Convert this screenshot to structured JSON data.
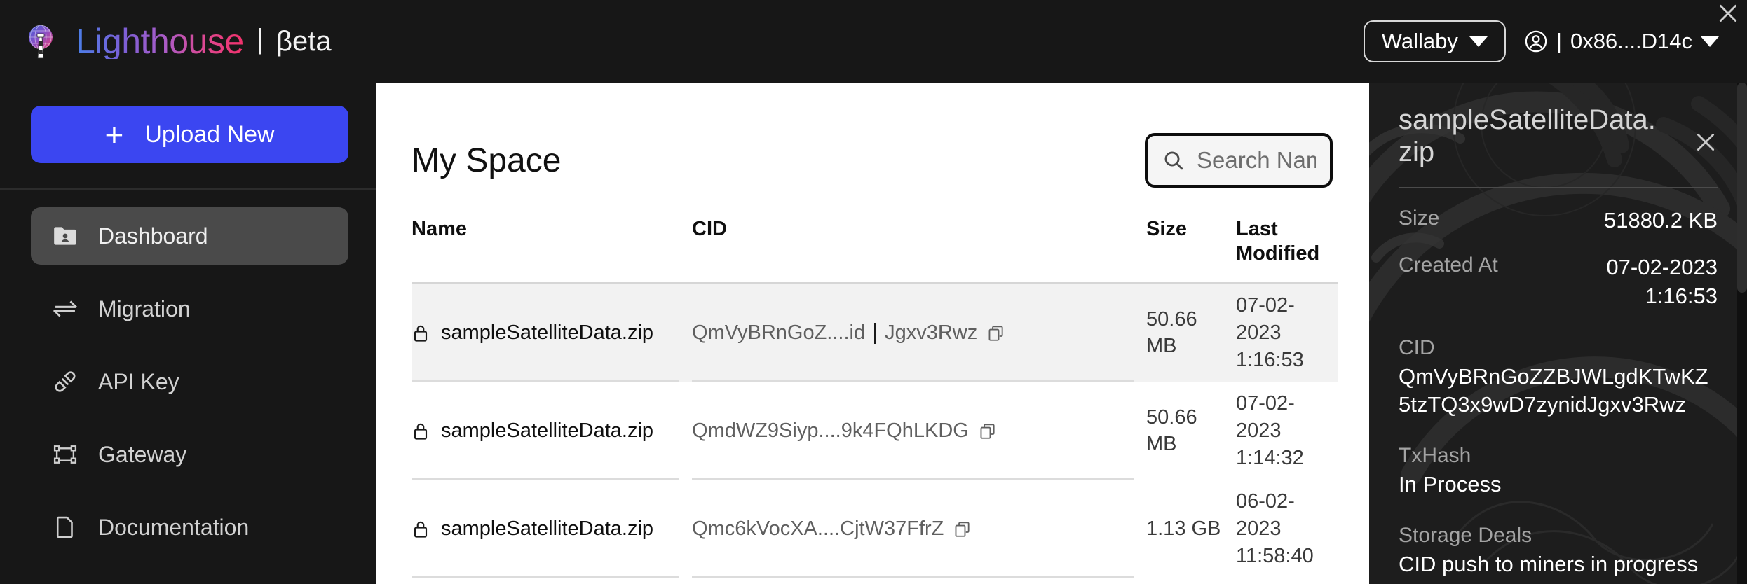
{
  "app": {
    "brand_name": "Lighthouse",
    "brand_separator": "|",
    "brand_tag": "βeta",
    "accent_blue": "#3b46f1",
    "panel_bg": "#1d1d1d",
    "dark_bg": "#171717"
  },
  "topbar": {
    "network_label": "Wallaby",
    "account_separator": "|",
    "account_address": "0x86....D14c",
    "window_close": "×"
  },
  "sidebar": {
    "upload_label": "Upload New",
    "upload_icon": "plus-icon",
    "items": [
      {
        "label": "Dashboard",
        "icon": "folder-user-icon",
        "active": true
      },
      {
        "label": "Migration",
        "icon": "swap-arrows-icon",
        "active": false
      },
      {
        "label": "API Key",
        "icon": "plug-connector-icon",
        "active": false
      },
      {
        "label": "Gateway",
        "icon": "bounding-box-icon",
        "active": false
      },
      {
        "label": "Documentation",
        "icon": "document-page-icon",
        "active": false
      }
    ]
  },
  "main": {
    "title": "My Space",
    "search": {
      "placeholder": "Search Name",
      "value": "",
      "icon": "search-icon"
    },
    "table": {
      "columns": [
        "Name",
        "CID",
        "Size",
        "Last Modified"
      ],
      "last_modified_line1": "Last",
      "last_modified_line2": "Modified",
      "rows": [
        {
          "name": "sampleSatelliteData.zip",
          "cid_prefix": "QmVyBRnGoZ....id",
          "cid_suffix": "Jgxv3Rwz",
          "cid": "QmVyBRnGoZ....idJgxv3Rwz",
          "size": "50.66 MB",
          "size_line1": "50.66",
          "size_line2": "MB",
          "modified_line1": "07-02-",
          "modified_line2": "2023",
          "modified_line3": "1:16:53",
          "highlighted": true
        },
        {
          "name": "sampleSatelliteData.zip",
          "cid_prefix": "QmdWZ9Siyp....9k4FQhLKDG",
          "cid_suffix": "",
          "cid": "QmdWZ9Siyp....9k4FQhLKDG",
          "size": "50.66 MB",
          "size_line1": "50.66",
          "size_line2": "MB",
          "modified_line1": "07-02-",
          "modified_line2": "2023",
          "modified_line3": "1:14:32",
          "highlighted": false
        },
        {
          "name": "sampleSatelliteData.zip",
          "cid_prefix": "Qmc6kVocXA....CjtW37FfrZ",
          "cid_suffix": "",
          "cid": "Qmc6kVocXA....CjtW37FfrZ",
          "size": "1.13 GB",
          "size_line1": "1.13 GB",
          "size_line2": "",
          "modified_line1": "06-02-",
          "modified_line2": "2023",
          "modified_line3": "11:58:40",
          "highlighted": false
        }
      ]
    }
  },
  "detail": {
    "title": "sampleSatelliteData.zip",
    "close_icon": "close-icon",
    "size_label": "Size",
    "size_value": "51880.2 KB",
    "created_label": "Created At",
    "created_value_line1": "07-02-2023",
    "created_value_line2": "1:16:53",
    "cid_label": "CID",
    "cid_value": "QmVyBRnGoZZBJWLgdKTwKZ5tzTQ3x9wD7zynidJgxv3Rwz",
    "txhash_label": "TxHash",
    "txhash_value": "In Process",
    "deals_label": "Storage Deals",
    "deals_value": "CID push to miners in progress"
  }
}
